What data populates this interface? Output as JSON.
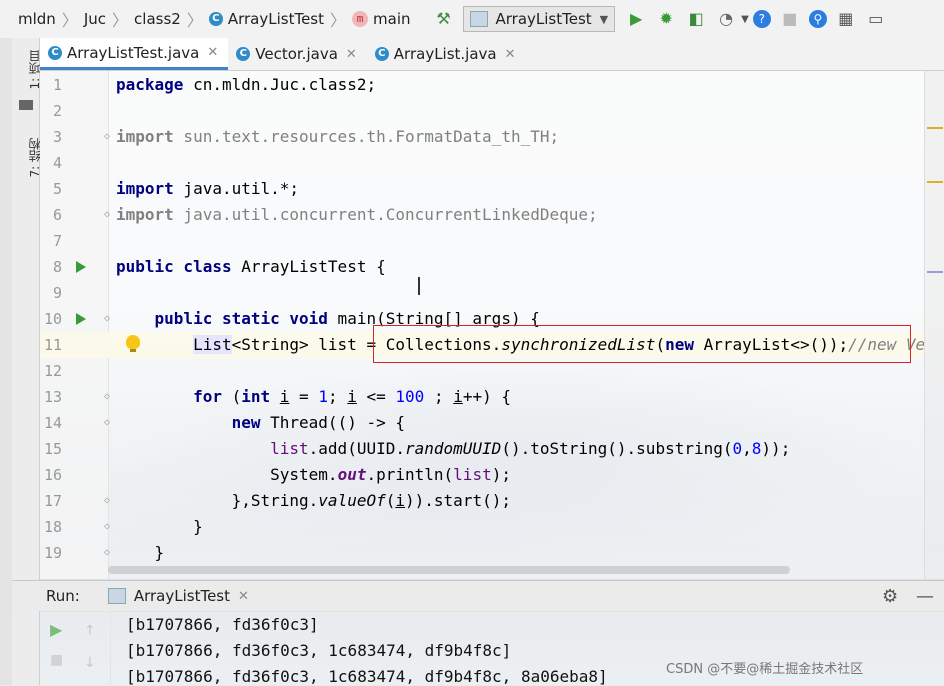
{
  "breadcrumbs": [
    "mldn",
    "Juc",
    "class2",
    "ArrayListTest",
    "main"
  ],
  "toolbar": {
    "run_config": "ArrayListTest",
    "icons": [
      "hammer-icon",
      "run-icon",
      "debug-icon",
      "coverage-icon",
      "profile-icon",
      "help-icon",
      "stop-icon",
      "search-icon",
      "project-structure-icon",
      "terminal-icon"
    ]
  },
  "editor_tabs": [
    {
      "label": "ArrayListTest.java",
      "icon": "c-class-icon",
      "active": true
    },
    {
      "label": "Vector.java",
      "icon": "c-class-icon",
      "active": false
    },
    {
      "label": "ArrayList.java",
      "icon": "c-class-icon",
      "active": false
    }
  ],
  "side_tools": {
    "project": "1: 项目",
    "structure": "7: 结构"
  },
  "code": {
    "l1": "1",
    "l2": "2",
    "l3": "3",
    "l4": "4",
    "l5": "5",
    "l6": "6",
    "l7": "7",
    "l8": "8",
    "l9": "9",
    "l10": "10",
    "l11": "11",
    "l12": "12",
    "l13": "13",
    "l14": "14",
    "l15": "15",
    "l16": "16",
    "l17": "17",
    "l18": "18",
    "l19": "19"
  },
  "run_panel": {
    "label": "Run:",
    "tab": "ArrayListTest",
    "output": [
      "[b1707866, fd36f0c3]",
      "[b1707866, fd36f0c3, 1c683474, df9b4f8c]",
      "[b1707866, fd36f0c3, 1c683474, df9b4f8c, 8a06eba8]"
    ]
  },
  "watermark": "CSDN @不要@稀土掘金技术社区",
  "colors": {
    "keyword": "#000080",
    "number": "#0000ff",
    "highlight_box": "#d62525",
    "tab_underline": "#4083c9"
  }
}
